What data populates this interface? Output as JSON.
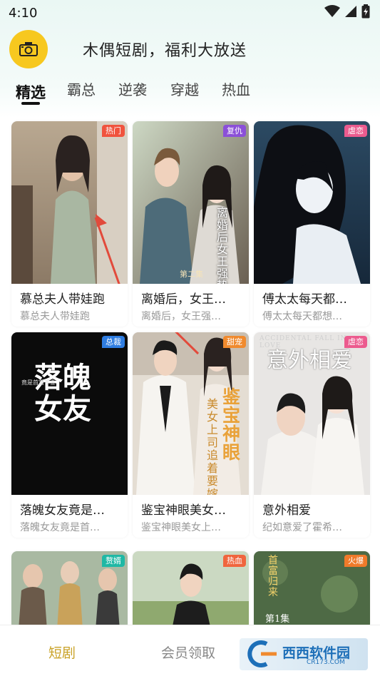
{
  "status": {
    "time": "4:10"
  },
  "header": {
    "title": "木偶短剧，福利大放送"
  },
  "tabs": [
    {
      "label": "精选"
    },
    {
      "label": "霸总"
    },
    {
      "label": "逆袭"
    },
    {
      "label": "穿越"
    },
    {
      "label": "热血"
    }
  ],
  "cards": [
    {
      "badge": "热门",
      "title": "慕总夫人带娃跑",
      "subtitle": "慕总夫人带娃跑",
      "badge_color": "#f0533e"
    },
    {
      "badge": "复仇",
      "title": "离婚后，女王…",
      "subtitle": "离婚后，女王强…",
      "badge_color": "#8b4fd8"
    },
    {
      "badge": "虐恋",
      "title": "傅太太每天都…",
      "subtitle": "傅太太每天都想…",
      "badge_color": "#ec5b8e"
    },
    {
      "badge": "总裁",
      "title": "落魄女友竟是…",
      "subtitle": "落魄女友竟是首…",
      "badge_color": "#2f7de1"
    },
    {
      "badge": "甜宠",
      "title": "鉴宝神眼美女…",
      "subtitle": "鉴宝神眼美女上…",
      "badge_color": "#f08a2e"
    },
    {
      "badge": "虐恋",
      "title": "意外相爱",
      "subtitle": "纪如意爱了霍希…",
      "badge_color": "#ec5b8e"
    },
    {
      "badge": "赘婿",
      "title": "",
      "subtitle": "",
      "badge_color": "#1fb8a5"
    },
    {
      "badge": "热血",
      "title": "",
      "subtitle": "",
      "badge_color": "#f0653e"
    },
    {
      "badge": "火爆",
      "title": "",
      "subtitle": "",
      "badge_color": "#f07a2a"
    }
  ],
  "posters": {
    "p2_text": "离婚后女王强势归",
    "p2_sub": "第二集",
    "p4_big": "落魄女友",
    "p4_small": "竟是首富千金",
    "p5_big": "鉴宝神眼",
    "p5_small": "美女上司追着要嫁",
    "p6_big": "意外相爱",
    "p6_en": "ACCIDENTAL FALL IN LOVE",
    "p9_text": "首富归来",
    "p9_ep": "第1集"
  },
  "bottom_nav": [
    {
      "label": "短剧",
      "active": true
    },
    {
      "label": "会员领取",
      "active": false
    }
  ],
  "watermark": {
    "text": "西西软件园",
    "sub": "CR173.COM"
  }
}
